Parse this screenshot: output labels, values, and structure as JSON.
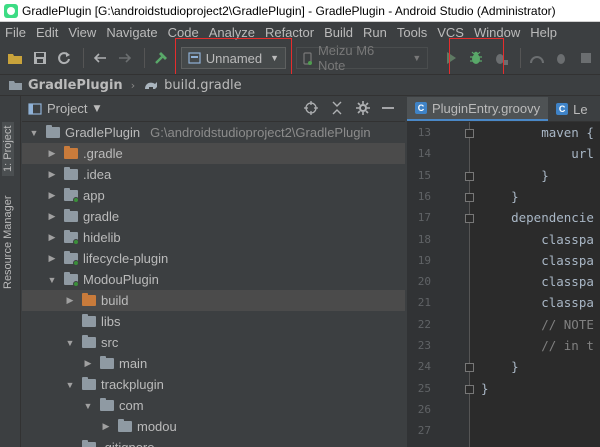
{
  "window": {
    "title": "GradlePlugin [G:\\androidstudioproject2\\GradlePlugin] - GradlePlugin - Android Studio (Administrator)"
  },
  "menu": [
    "File",
    "Edit",
    "View",
    "Navigate",
    "Code",
    "Analyze",
    "Refactor",
    "Build",
    "Run",
    "Tools",
    "VCS",
    "Window",
    "Help"
  ],
  "toolbar": {
    "run_config": "Unnamed",
    "device": "Meizu M6 Note"
  },
  "breadcrumb": {
    "project": "GradlePlugin",
    "file": "build.gradle"
  },
  "stripe": {
    "project_tab": "1: Project",
    "resource_tab": "Resource Manager"
  },
  "project_panel": {
    "label": "Project"
  },
  "tree": [
    {
      "label": "GradlePlugin",
      "path": "G:\\androidstudioproject2\\GradlePlugin",
      "depth": 0,
      "expanded": true,
      "folder": "gray"
    },
    {
      "label": ".gradle",
      "depth": 1,
      "expanded": false,
      "folder": "orange",
      "selected": true
    },
    {
      "label": ".idea",
      "depth": 1,
      "expanded": false,
      "folder": "gray"
    },
    {
      "label": "app",
      "depth": 1,
      "expanded": false,
      "folder": "gray",
      "module": true
    },
    {
      "label": "gradle",
      "depth": 1,
      "expanded": false,
      "folder": "gray"
    },
    {
      "label": "hidelib",
      "depth": 1,
      "expanded": false,
      "folder": "gray",
      "module": true
    },
    {
      "label": "lifecycle-plugin",
      "depth": 1,
      "expanded": false,
      "folder": "gray",
      "module": true
    },
    {
      "label": "ModouPlugin",
      "depth": 1,
      "expanded": true,
      "folder": "gray",
      "module": true
    },
    {
      "label": "build",
      "depth": 2,
      "expanded": false,
      "folder": "orange",
      "selected": true
    },
    {
      "label": "libs",
      "depth": 2,
      "leaf": true,
      "folder": "gray"
    },
    {
      "label": "src",
      "depth": 2,
      "expanded": true,
      "folder": "gray"
    },
    {
      "label": "main",
      "depth": 3,
      "expanded": false,
      "folder": "gray"
    },
    {
      "label": "trackplugin",
      "depth": 2,
      "expanded": true,
      "folder": "gray"
    },
    {
      "label": "com",
      "depth": 3,
      "expanded": true,
      "folder": "gray"
    },
    {
      "label": "modou",
      "depth": 4,
      "expanded": false,
      "folder": "gray"
    },
    {
      "label": ".gitignore",
      "depth": 2,
      "leaf": true,
      "folder": "gray"
    }
  ],
  "editor": {
    "tabs": [
      {
        "label": "PluginEntry.groovy",
        "active": true
      },
      {
        "label": "Le",
        "active": false
      }
    ],
    "lines": [
      {
        "n": "13",
        "text": "        maven {",
        "fold": true
      },
      {
        "n": "14",
        "text": "            url",
        "fold": false
      },
      {
        "n": "15",
        "text": "        }",
        "fold": true
      },
      {
        "n": "16",
        "text": "    }",
        "fold": true
      },
      {
        "n": "17",
        "text": "    dependencie",
        "fold": true
      },
      {
        "n": "18",
        "text": "        classpa",
        "fold": false
      },
      {
        "n": "19",
        "text": "        classpa",
        "fold": false
      },
      {
        "n": "20",
        "text": "        classpa",
        "fold": false
      },
      {
        "n": "21",
        "text": "        classpa",
        "fold": false
      },
      {
        "n": "22",
        "text": "        // NOTE",
        "fold": false,
        "comment": true
      },
      {
        "n": "23",
        "text": "        // in t",
        "fold": false,
        "comment": true
      },
      {
        "n": "24",
        "text": "    }",
        "fold": true
      },
      {
        "n": "25",
        "text": "}",
        "fold": true
      },
      {
        "n": "26",
        "text": "",
        "fold": false
      },
      {
        "n": "27",
        "text": "",
        "fold": false
      }
    ]
  },
  "colors": {
    "highlight": "#e52d2d",
    "accent": "#4a88c7",
    "debug_green": "#59a869"
  }
}
